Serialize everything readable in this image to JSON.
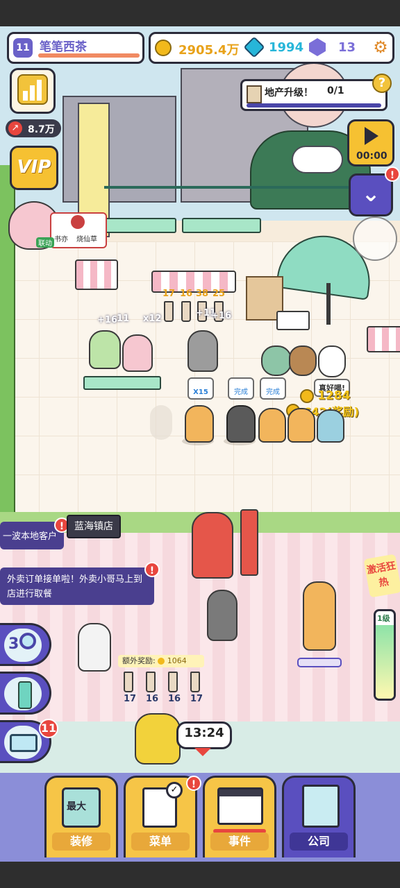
{
  "header": {
    "level": "11",
    "shop_name": "笔笔西茶",
    "coins": "2905.4万",
    "gems": "1994",
    "crystals": "13"
  },
  "left_panel": {
    "income": "8.7万",
    "vip_label": "VIP",
    "collab_label": "联动",
    "collab_brand": "书亦",
    "collab_brand2": "烧仙草"
  },
  "quest": {
    "label": "地产升级！",
    "progress": "0/1",
    "help": "?"
  },
  "video_timer": "00:00",
  "notices": {
    "local_customers": "一波本地客户",
    "store_name": "蓝海镇店",
    "delivery": "外卖订单接单啦！外卖小哥马上到店进行取餐"
  },
  "stock": {
    "labels": [
      "17",
      "16",
      "38",
      "25"
    ]
  },
  "queue_tags": [
    "+16",
    "11",
    "x12",
    "+11",
    "+16"
  ],
  "speech": {
    "x15": "X15",
    "done1": "完成",
    "done2": "完成",
    "tasty": "真好喝!",
    "coin_reward": "1284",
    "bonus_reward": "642(奖励)"
  },
  "event": {
    "activate": "激活狂热",
    "level": "1级"
  },
  "extra_reward": {
    "label": "额外奖励:",
    "amount": "1064",
    "cups": [
      "17",
      "16",
      "16",
      "17"
    ]
  },
  "delivery_timer": "13:24",
  "side_buttons": {
    "search_count": "3",
    "badge": "11"
  },
  "tabs": [
    {
      "label": "装修",
      "sub": "最大"
    },
    {
      "label": "菜单"
    },
    {
      "label": "事件"
    },
    {
      "label": "公司"
    }
  ],
  "colors": {
    "accent_purple": "#5a4fbf",
    "coin_gold": "#f2b91b",
    "gem_teal": "#27b6d9",
    "alert_red": "#e8463e"
  }
}
